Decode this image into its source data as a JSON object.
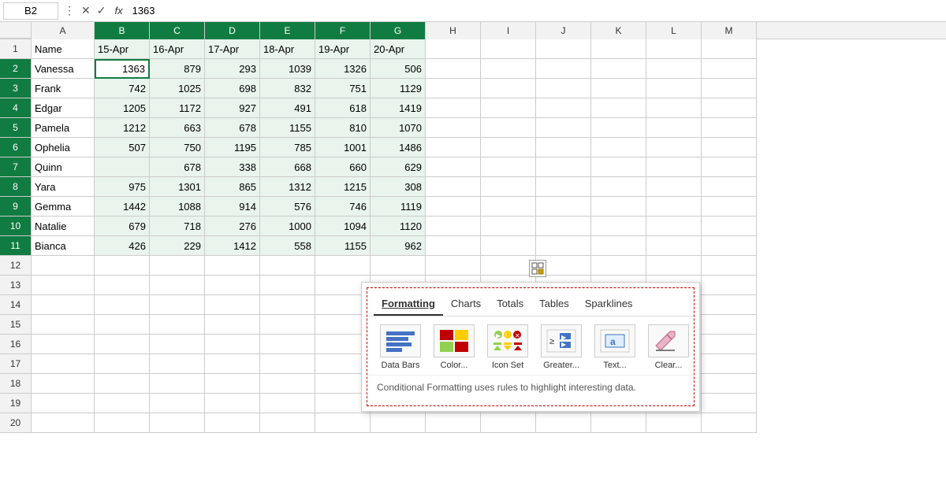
{
  "formulaBar": {
    "cellRef": "B2",
    "value": "1363",
    "fxLabel": "fx"
  },
  "columns": [
    "A",
    "B",
    "C",
    "D",
    "E",
    "F",
    "G",
    "H",
    "I",
    "J",
    "K",
    "L",
    "M"
  ],
  "columnWidths": {
    "A": 80,
    "B": 70,
    "C": 70,
    "D": 70,
    "E": 70,
    "F": 70,
    "G": 70,
    "H": 70,
    "I": 70,
    "J": 70,
    "K": 70,
    "L": 70,
    "M": 70
  },
  "headers": [
    "Name",
    "15-Apr",
    "16-Apr",
    "17-Apr",
    "18-Apr",
    "19-Apr",
    "20-Apr",
    "",
    "",
    "",
    "",
    "",
    ""
  ],
  "rows": [
    {
      "num": 2,
      "data": [
        "Vanessa",
        "1363",
        "879",
        "293",
        "1039",
        "1326",
        "506",
        "",
        "",
        "",
        "",
        "",
        ""
      ]
    },
    {
      "num": 3,
      "data": [
        "Frank",
        "742",
        "1025",
        "698",
        "832",
        "751",
        "1129",
        "",
        "",
        "",
        "",
        "",
        ""
      ]
    },
    {
      "num": 4,
      "data": [
        "Edgar",
        "1205",
        "1172",
        "927",
        "491",
        "618",
        "1419",
        "",
        "",
        "",
        "",
        "",
        ""
      ]
    },
    {
      "num": 5,
      "data": [
        "Pamela",
        "1212",
        "663",
        "678",
        "1155",
        "810",
        "1070",
        "",
        "",
        "",
        "",
        "",
        ""
      ]
    },
    {
      "num": 6,
      "data": [
        "Ophelia",
        "507",
        "750",
        "1195",
        "785",
        "1001",
        "1486",
        "",
        "",
        "",
        "",
        "",
        ""
      ]
    },
    {
      "num": 7,
      "data": [
        "Quinn",
        "",
        "678",
        "338",
        "668",
        "660",
        "629",
        "",
        "",
        "",
        "",
        "",
        ""
      ]
    },
    {
      "num": 8,
      "data": [
        "Yara",
        "975",
        "1301",
        "865",
        "1312",
        "1215",
        "308",
        "",
        "",
        "",
        "",
        "",
        ""
      ]
    },
    {
      "num": 9,
      "data": [
        "Gemma",
        "1442",
        "1088",
        "914",
        "576",
        "746",
        "1119",
        "",
        "",
        "",
        "",
        "",
        ""
      ]
    },
    {
      "num": 10,
      "data": [
        "Natalie",
        "679",
        "718",
        "276",
        "1000",
        "1094",
        "1120",
        "",
        "",
        "",
        "",
        "",
        ""
      ]
    },
    {
      "num": 11,
      "data": [
        "Bianca",
        "426",
        "229",
        "1412",
        "558",
        "1155",
        "962",
        "",
        "",
        "",
        "",
        "",
        ""
      ]
    },
    {
      "num": 12,
      "data": [
        "",
        "",
        "",
        "",
        "",
        "",
        "",
        "",
        "",
        "",
        "",
        "",
        ""
      ]
    },
    {
      "num": 13,
      "data": [
        "",
        "",
        "",
        "",
        "",
        "",
        "",
        "",
        "",
        "",
        "",
        "",
        ""
      ]
    },
    {
      "num": 14,
      "data": [
        "",
        "",
        "",
        "",
        "",
        "",
        "",
        "",
        "",
        "",
        "",
        "",
        ""
      ]
    },
    {
      "num": 15,
      "data": [
        "",
        "",
        "",
        "",
        "",
        "",
        "",
        "",
        "",
        "",
        "",
        "",
        ""
      ]
    },
    {
      "num": 16,
      "data": [
        "",
        "",
        "",
        "",
        "",
        "",
        "",
        "",
        "",
        "",
        "",
        "",
        ""
      ]
    },
    {
      "num": 17,
      "data": [
        "",
        "",
        "",
        "",
        "",
        "",
        "",
        "",
        "",
        "",
        "",
        "",
        ""
      ]
    },
    {
      "num": 18,
      "data": [
        "",
        "",
        "",
        "",
        "",
        "",
        "",
        "",
        "",
        "",
        "",
        "",
        ""
      ]
    },
    {
      "num": 19,
      "data": [
        "",
        "",
        "",
        "",
        "",
        "",
        "",
        "",
        "",
        "",
        "",
        "",
        ""
      ]
    },
    {
      "num": 20,
      "data": [
        "",
        "",
        "",
        "",
        "",
        "",
        "",
        "",
        "",
        "",
        "",
        "",
        ""
      ]
    }
  ],
  "quickAnalysis": {
    "triggerIcon": "⊞",
    "tabs": [
      "Formatting",
      "Charts",
      "Totals",
      "Tables",
      "Sparklines"
    ],
    "activeTab": "Formatting",
    "icons": [
      {
        "label": "Data Bars",
        "iconType": "data-bars"
      },
      {
        "label": "Color...",
        "iconType": "color"
      },
      {
        "label": "Icon Set",
        "iconType": "icon-set"
      },
      {
        "label": "Greater...",
        "iconType": "greater"
      },
      {
        "label": "Text...",
        "iconType": "text"
      },
      {
        "label": "Clear...",
        "iconType": "clear"
      }
    ],
    "description": "Conditional Formatting uses rules to highlight interesting data."
  }
}
